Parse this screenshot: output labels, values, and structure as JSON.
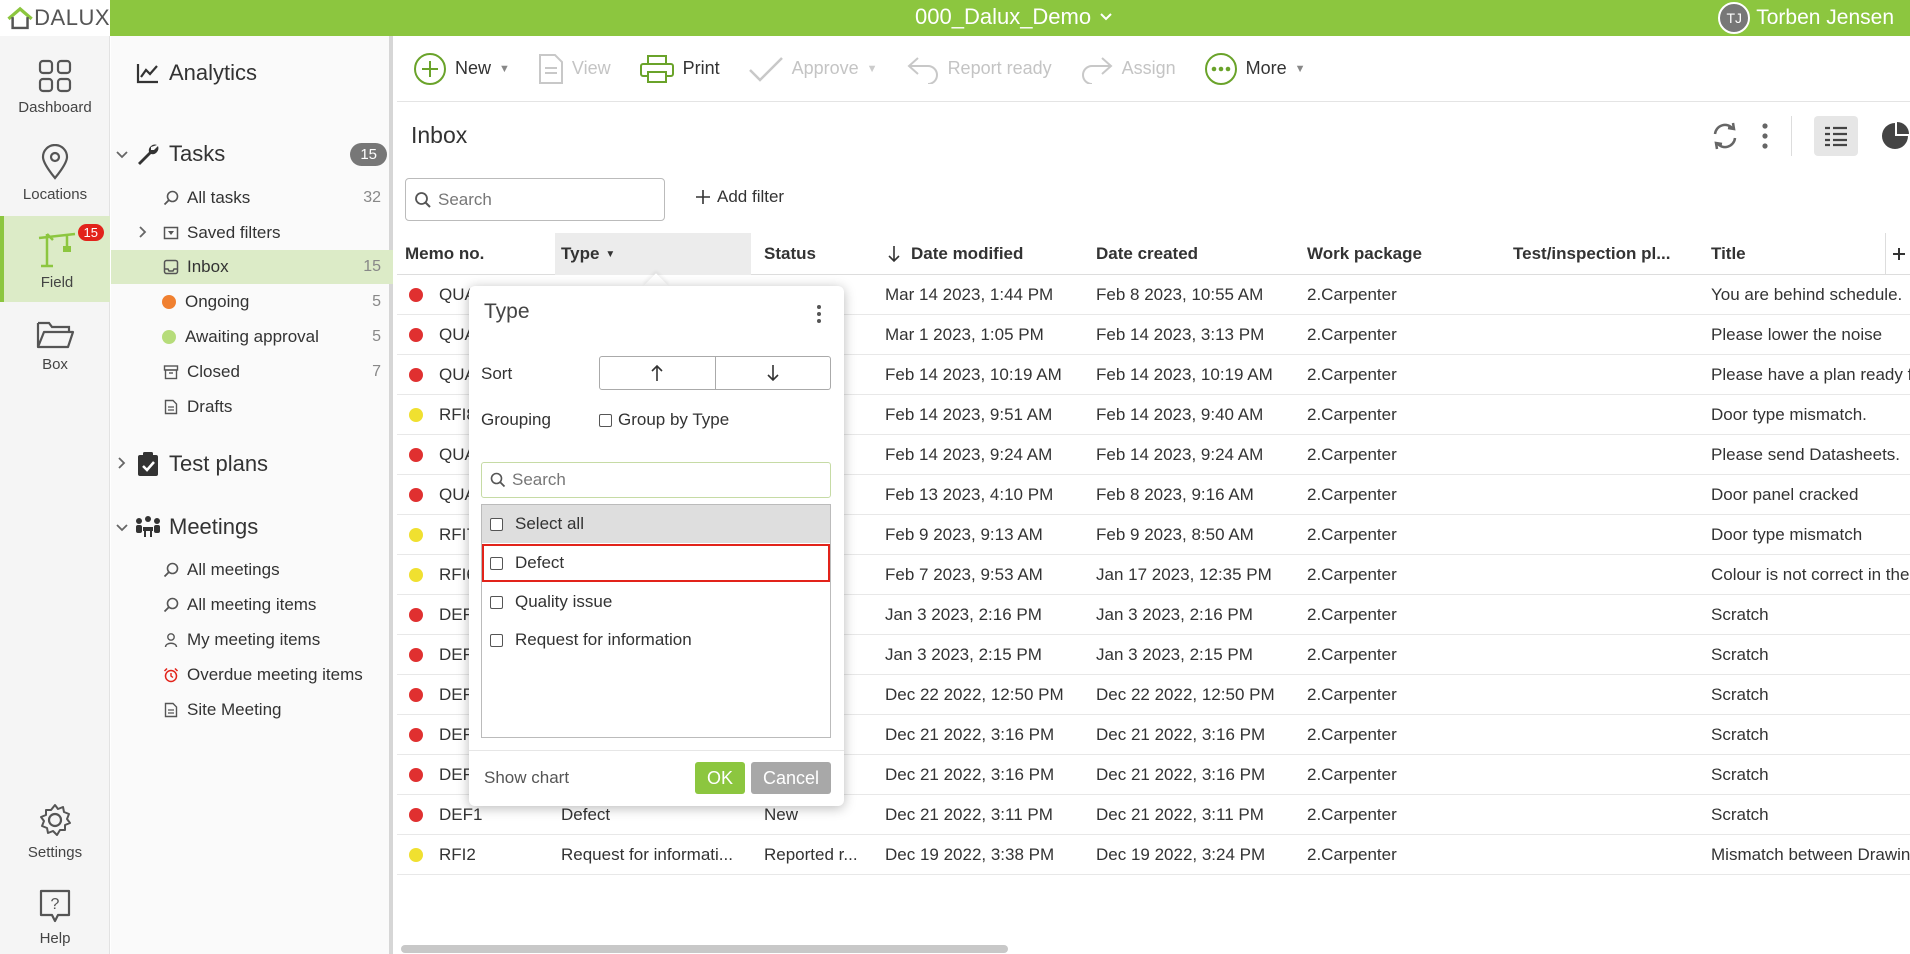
{
  "header": {
    "logo_text": "DALUX",
    "project_name": "000_Dalux_Demo",
    "user_initials": "TJ",
    "user_name": "Torben Jensen",
    "brand_color": "#8cc63f"
  },
  "leftnav": {
    "items": [
      {
        "label": "Dashboard",
        "icon": "dashboard-icon"
      },
      {
        "label": "Locations",
        "icon": "location-pin-icon"
      },
      {
        "label": "Field",
        "icon": "crane-icon",
        "badge": "15"
      },
      {
        "label": "Box",
        "icon": "folder-icon"
      },
      {
        "label": "Settings",
        "icon": "gear-icon"
      },
      {
        "label": "Help",
        "icon": "help-icon"
      }
    ]
  },
  "sidebar": {
    "analytics": "Analytics",
    "tasks": {
      "label": "Tasks",
      "count": "15"
    },
    "task_items": [
      {
        "label": "All tasks",
        "count": "32"
      },
      {
        "label": "Saved filters",
        "count": ""
      },
      {
        "label": "Inbox",
        "count": "15"
      },
      {
        "label": "Ongoing",
        "count": "5"
      },
      {
        "label": "Awaiting approval",
        "count": "5"
      },
      {
        "label": "Closed",
        "count": "7"
      },
      {
        "label": "Drafts",
        "count": ""
      }
    ],
    "test_plans": "Test plans",
    "meetings": "Meetings",
    "meeting_items": [
      {
        "label": "All meetings"
      },
      {
        "label": "All meeting items"
      },
      {
        "label": "My meeting items"
      },
      {
        "label": "Overdue meeting items"
      },
      {
        "label": "Site Meeting"
      }
    ]
  },
  "toolbar": {
    "new": "New",
    "view": "View",
    "print": "Print",
    "approve": "Approve",
    "report_ready": "Report ready",
    "assign": "Assign",
    "more": "More"
  },
  "main": {
    "title": "Inbox",
    "search_placeholder": "Search",
    "add_filter": "Add filter"
  },
  "table": {
    "headers": [
      "Memo no.",
      "Type",
      "Status",
      "Date modified",
      "Date created",
      "Work package",
      "Test/inspection pl...",
      "Title"
    ],
    "rows": [
      {
        "status_color": "#e03030",
        "memo": "QUA",
        "type": "",
        "status": "",
        "modified": "Mar 14 2023, 1:44 PM",
        "created": "Feb 8 2023, 10:55 AM",
        "package": "2.Carpenter",
        "inspection": "",
        "title": "You are behind schedule."
      },
      {
        "status_color": "#e03030",
        "memo": "QUA",
        "type": "",
        "status": "",
        "modified": "Mar 1 2023, 1:05 PM",
        "created": "Feb 14 2023, 3:13 PM",
        "package": "2.Carpenter",
        "inspection": "",
        "title": "Please lower the noise"
      },
      {
        "status_color": "#e03030",
        "memo": "QUA",
        "type": "",
        "status": "",
        "modified": "Feb 14 2023, 10:19 AM",
        "created": "Feb 14 2023, 10:19 AM",
        "package": "2.Carpenter",
        "inspection": "",
        "title": "Please have a plan ready f"
      },
      {
        "status_color": "#f0e030",
        "memo": "RFI8",
        "type": "",
        "status": "...",
        "modified": "Feb 14 2023, 9:51 AM",
        "created": "Feb 14 2023, 9:40 AM",
        "package": "2.Carpenter",
        "inspection": "",
        "title": "Door type mismatch."
      },
      {
        "status_color": "#e03030",
        "memo": "QUA",
        "type": "",
        "status": "",
        "modified": "Feb 14 2023, 9:24 AM",
        "created": "Feb 14 2023, 9:24 AM",
        "package": "2.Carpenter",
        "inspection": "",
        "title": "Please send Datasheets."
      },
      {
        "status_color": "#e03030",
        "memo": "QUA",
        "type": "",
        "status": "",
        "modified": "Feb 13 2023, 4:10 PM",
        "created": "Feb 8 2023, 9:16 AM",
        "package": "2.Carpenter",
        "inspection": "",
        "title": "Door panel cracked"
      },
      {
        "status_color": "#f0e030",
        "memo": "RFI7",
        "type": "",
        "status": "...",
        "modified": "Feb 9 2023, 9:13 AM",
        "created": "Feb 9 2023, 8:50 AM",
        "package": "2.Carpenter",
        "inspection": "",
        "title": "Door type mismatch"
      },
      {
        "status_color": "#f0e030",
        "memo": "RFI6",
        "type": "",
        "status": "...",
        "modified": "Feb 7 2023, 9:53 AM",
        "created": "Jan 17 2023, 12:35 PM",
        "package": "2.Carpenter",
        "inspection": "",
        "title": "Colour is not correct in the"
      },
      {
        "status_color": "#e03030",
        "memo": "DEF",
        "type": "",
        "status": "",
        "modified": "Jan 3 2023, 2:16 PM",
        "created": "Jan 3 2023, 2:16 PM",
        "package": "2.Carpenter",
        "inspection": "",
        "title": "Scratch"
      },
      {
        "status_color": "#e03030",
        "memo": "DEF",
        "type": "",
        "status": "",
        "modified": "Jan 3 2023, 2:15 PM",
        "created": "Jan 3 2023, 2:15 PM",
        "package": "2.Carpenter",
        "inspection": "",
        "title": "Scratch"
      },
      {
        "status_color": "#e03030",
        "memo": "DEF",
        "type": "",
        "status": "",
        "modified": "Dec 22 2022, 12:50 PM",
        "created": "Dec 22 2022, 12:50 PM",
        "package": "2.Carpenter",
        "inspection": "",
        "title": "Scratch"
      },
      {
        "status_color": "#e03030",
        "memo": "DEF",
        "type": "",
        "status": "",
        "modified": "Dec 21 2022, 3:16 PM",
        "created": "Dec 21 2022, 3:16 PM",
        "package": "2.Carpenter",
        "inspection": "",
        "title": "Scratch"
      },
      {
        "status_color": "#e03030",
        "memo": "DEF",
        "type": "",
        "status": "",
        "modified": "Dec 21 2022, 3:16 PM",
        "created": "Dec 21 2022, 3:16 PM",
        "package": "2.Carpenter",
        "inspection": "",
        "title": "Scratch"
      },
      {
        "status_color": "#e03030",
        "memo": "DEF1",
        "type": "Defect",
        "status": "New",
        "modified": "Dec 21 2022, 3:11 PM",
        "created": "Dec 21 2022, 3:11 PM",
        "package": "2.Carpenter",
        "inspection": "",
        "title": "Scratch"
      },
      {
        "status_color": "#f0e030",
        "memo": "RFI2",
        "type": "Request for informati...",
        "status": "Reported r...",
        "modified": "Dec 19 2022, 3:38 PM",
        "created": "Dec 19 2022, 3:24 PM",
        "package": "2.Carpenter",
        "inspection": "",
        "title": "Mismatch between Drawin"
      }
    ]
  },
  "popup": {
    "title": "Type",
    "sort_label": "Sort",
    "grouping_label": "Grouping",
    "group_by": "Group by Type",
    "search_placeholder": "Search",
    "options": [
      "Select all",
      "Defect",
      "Quality issue",
      "Request for information"
    ],
    "show_chart": "Show chart",
    "ok": "OK",
    "cancel": "Cancel"
  }
}
